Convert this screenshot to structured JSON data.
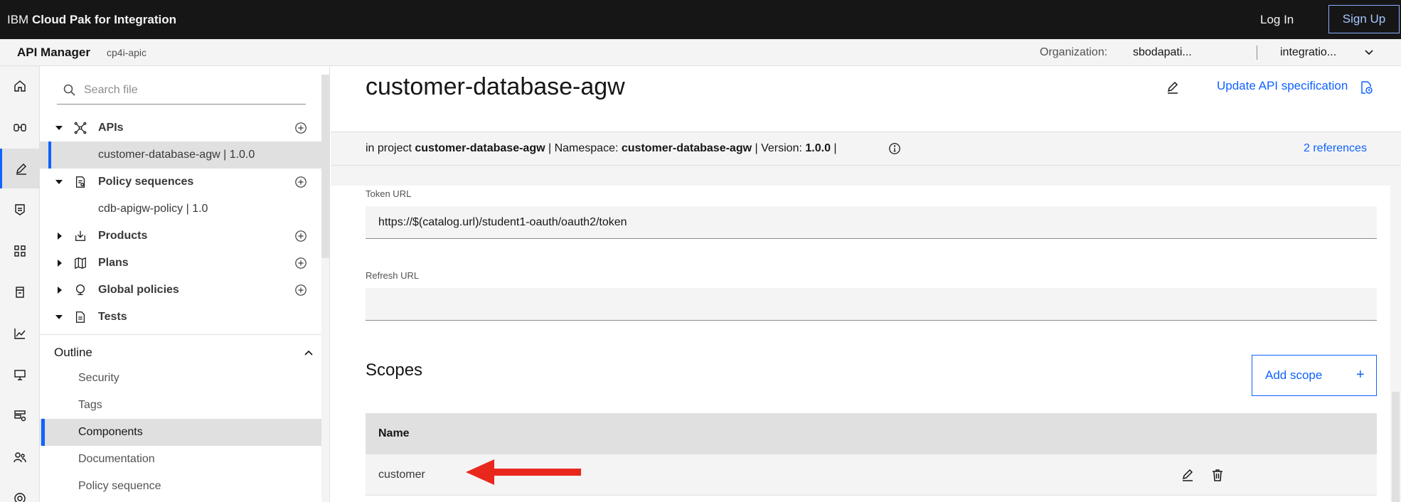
{
  "topbar": {
    "brand_prefix": "IBM",
    "brand_name": "Cloud Pak for Integration",
    "login_label": "Log In",
    "signup_label": "Sign Up"
  },
  "subbar": {
    "app_name": "API Manager",
    "instance": "cp4i-apic",
    "org_label": "Organization:",
    "org_value": "sbodapati...",
    "catalog_value": "integratio..."
  },
  "rail": {
    "icons": [
      "home-icon",
      "explore-icon",
      "develop-icon",
      "manage-icon",
      "apps-icon",
      "resources-icon",
      "analytics-icon",
      "test-icon",
      "catalog-settings-icon",
      "members-icon",
      "settings-icon"
    ],
    "active_index": 2
  },
  "tree": {
    "search_placeholder": "Search file",
    "apis_label": "APIs",
    "api_child": "customer-database-agw | 1.0.0",
    "policy_label": "Policy sequences",
    "policy_child": "cdb-apigw-policy | 1.0",
    "products_label": "Products",
    "plans_label": "Plans",
    "global_label": "Global policies",
    "tests_label": "Tests"
  },
  "outline": {
    "title": "Outline",
    "items": [
      "Security",
      "Tags",
      "Components",
      "Documentation",
      "Policy sequence"
    ],
    "selected": "Components"
  },
  "main": {
    "title": "customer-database-agw",
    "update_link": "Update API specification",
    "meta": {
      "prefix": "in project",
      "project": "customer-database-agw",
      "ns_label": "| Namespace:",
      "namespace": "customer-database-agw",
      "ver_label": "| Version:",
      "version": "1.0.0",
      "suffix": "|"
    },
    "references": "2 references",
    "token_url_label": "Token URL",
    "token_url_value": "https://$(catalog.url)/student1-oauth/oauth2/token",
    "refresh_url_label": "Refresh URL",
    "refresh_url_value": "",
    "scopes_title": "Scopes",
    "add_scope_label": "Add scope",
    "add_scope_plus": "+",
    "table_header": "Name",
    "rows": [
      "customer"
    ]
  },
  "colors": {
    "accent": "#0f62fe",
    "topbar": "#161616",
    "arrow": "#e8281c"
  }
}
